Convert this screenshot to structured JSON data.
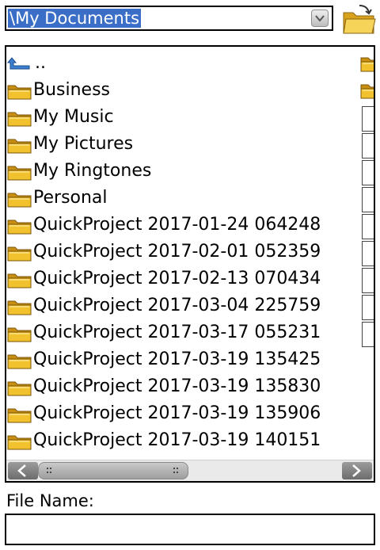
{
  "path": {
    "value": "\\My Documents"
  },
  "list": {
    "items": [
      {
        "name": "..",
        "type": "parent"
      },
      {
        "name": "Business",
        "type": "folder"
      },
      {
        "name": "My Music",
        "type": "folder"
      },
      {
        "name": "My Pictures",
        "type": "folder"
      },
      {
        "name": "My Ringtones",
        "type": "folder"
      },
      {
        "name": "Personal",
        "type": "folder"
      },
      {
        "name": "QuickProject 2017-01-24 064248",
        "type": "folder"
      },
      {
        "name": "QuickProject 2017-02-01 052359",
        "type": "folder"
      },
      {
        "name": "QuickProject 2017-02-13 070434",
        "type": "folder"
      },
      {
        "name": "QuickProject 2017-03-04 225759",
        "type": "folder"
      },
      {
        "name": "QuickProject 2017-03-17 055231",
        "type": "folder"
      },
      {
        "name": "QuickProject 2017-03-19 135425",
        "type": "folder"
      },
      {
        "name": "QuickProject 2017-03-19 135830",
        "type": "folder"
      },
      {
        "name": "QuickProject 2017-03-19 135906",
        "type": "folder"
      },
      {
        "name": "QuickProject 2017-03-19 140151",
        "type": "folder"
      }
    ],
    "second_column": [
      "folder",
      "folder",
      "file",
      "file",
      "file",
      "file",
      "file",
      "file",
      "file",
      "file",
      "file"
    ]
  },
  "file_name": {
    "label": "File Name:",
    "value": ""
  },
  "colors": {
    "selection": "#3b6fc7",
    "folder": "#f2c12e"
  }
}
